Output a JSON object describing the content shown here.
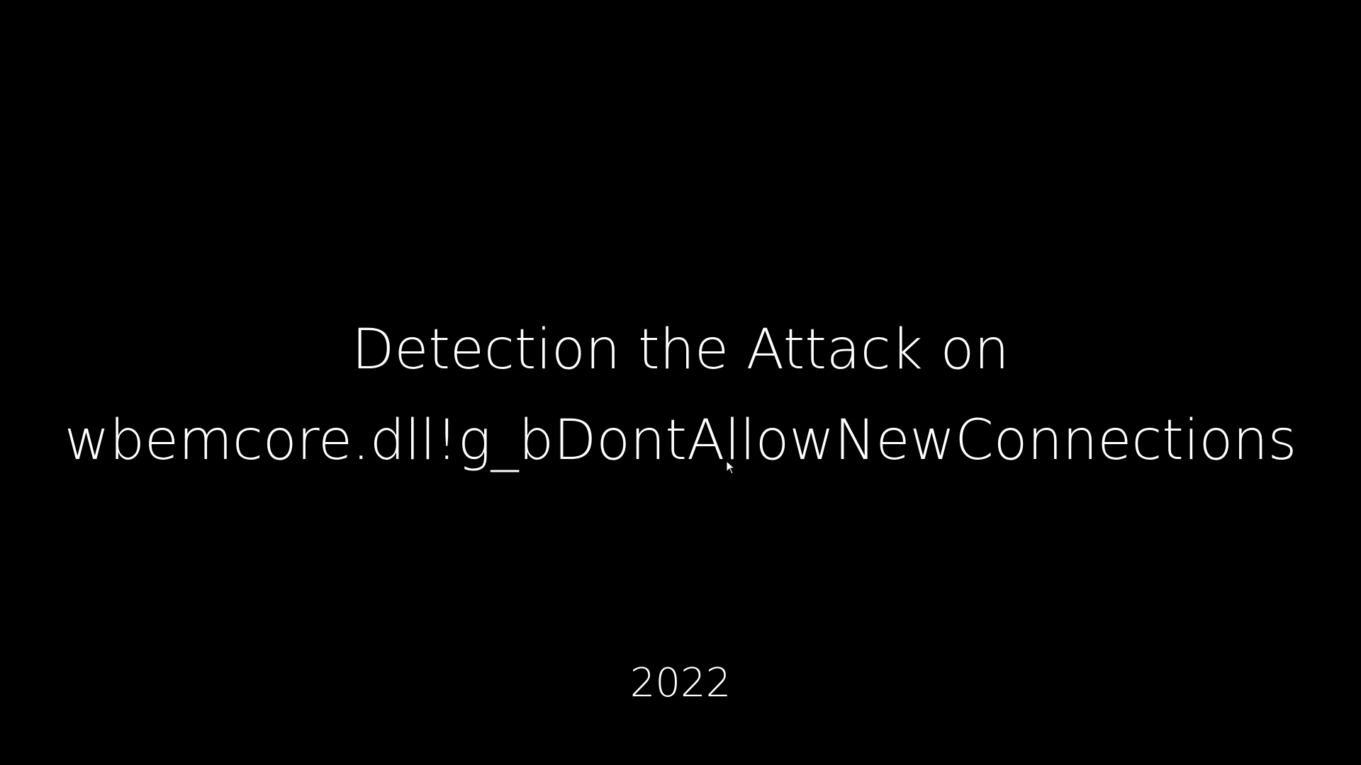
{
  "slide": {
    "title_line1": "Detection the Attack on",
    "title_line2": "wbemcore.dll!g_bDontAllowNewConnections",
    "year": "2022"
  },
  "colors": {
    "background": "#000000",
    "text": "#ffffff"
  },
  "icons": {
    "pointer": "mouse-pointer-icon"
  }
}
